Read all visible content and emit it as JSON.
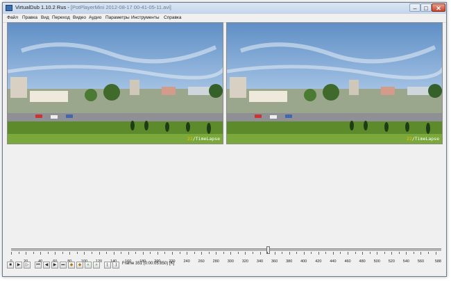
{
  "window": {
    "app_title": "VirtualDub 1.10.2 Rus - ",
    "file_title": "[PotPlayerMini 2012-08-17 00-41-05-11.avi]",
    "controls": {
      "minimize": "–",
      "maximize": "□",
      "close": "✕"
    }
  },
  "menu": [
    "Файл",
    "Правка",
    "Вид",
    "Переход",
    "Видео",
    "Аудио",
    "Параметры",
    "Инструменты",
    "Справка"
  ],
  "panes": {
    "input": {
      "watermark_number": "22",
      "watermark_text": "/TimeLapse"
    },
    "output": {
      "watermark_number": "22",
      "watermark_text": "/TimeLapse"
    }
  },
  "timeline": {
    "min": 0,
    "max": 588,
    "current_frame": 351,
    "tick_labels": [
      "0",
      "20",
      "40",
      "60",
      "80",
      "100",
      "120",
      "140",
      "160",
      "180",
      "200",
      "220",
      "240",
      "260",
      "280",
      "300",
      "320",
      "340",
      "360",
      "380",
      "400",
      "420",
      "440",
      "460",
      "480",
      "500",
      "520",
      "540",
      "560",
      "588"
    ]
  },
  "toolbar": {
    "buttons": [
      {
        "name": "stop-icon",
        "glyph": "■"
      },
      {
        "name": "play-input-icon",
        "glyph": "▶"
      },
      {
        "name": "play-output-icon",
        "glyph": "▷"
      },
      {
        "name": "go-start-icon",
        "glyph": "⏮"
      },
      {
        "name": "prev-frame-icon",
        "glyph": "◀"
      },
      {
        "name": "next-frame-icon",
        "glyph": "▶"
      },
      {
        "name": "go-end-icon",
        "glyph": "⏭"
      },
      {
        "name": "prev-keyframe-icon",
        "glyph": "◆"
      },
      {
        "name": "next-keyframe-icon",
        "glyph": "◆"
      },
      {
        "name": "scene-back-icon",
        "glyph": "«"
      },
      {
        "name": "scene-forward-icon",
        "glyph": "»"
      },
      {
        "name": "mark-in-icon",
        "glyph": "⌊"
      },
      {
        "name": "mark-out-icon",
        "glyph": "⌋"
      }
    ],
    "frame_status": "Frame 351 (0:00:05.850) [K]"
  }
}
